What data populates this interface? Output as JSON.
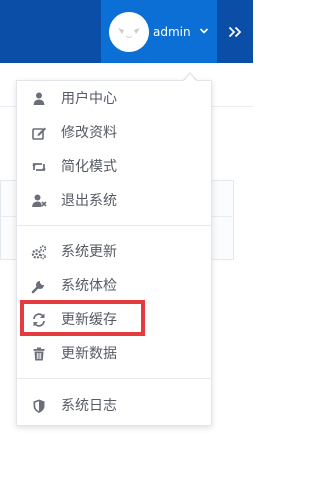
{
  "header": {
    "username": "admin",
    "colors": {
      "bar": "#0b4ea8",
      "user_area": "#0c6fd6"
    }
  },
  "dropdown": {
    "groups": [
      [
        {
          "label": "用户中心",
          "icon": "user-icon"
        },
        {
          "label": "修改资料",
          "icon": "edit-icon"
        },
        {
          "label": "简化模式",
          "icon": "retweet-icon"
        },
        {
          "label": "退出系统",
          "icon": "user-times-icon"
        }
      ],
      [
        {
          "label": "系统更新",
          "icon": "cogs-icon"
        },
        {
          "label": "系统体检",
          "icon": "wrench-icon"
        },
        {
          "label": "更新缓存",
          "icon": "refresh-icon"
        },
        {
          "label": "更新数据",
          "icon": "trash-icon"
        }
      ],
      [
        {
          "label": "系统日志",
          "icon": "shield-icon"
        }
      ]
    ],
    "highlighted_item": "更新缓存",
    "highlight_color": "#e53b3f"
  }
}
